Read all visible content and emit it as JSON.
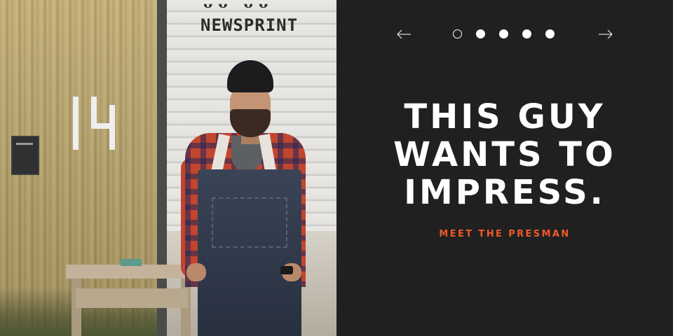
{
  "photo": {
    "door_text": "NEWSPRINT",
    "building_number": "14"
  },
  "slider": {
    "prev_icon": "arrow-left-icon",
    "next_icon": "arrow-right-icon",
    "dot_count": 5,
    "active_index": 0
  },
  "headline": {
    "lines": [
      "THIS GUY",
      "WANTS TO",
      "IMPRESS."
    ]
  },
  "cta": {
    "label": "MEET THE PRESMAN"
  },
  "colors": {
    "panel_bg": "#202020",
    "text": "#ffffff",
    "accent": "#ef5a2a"
  }
}
